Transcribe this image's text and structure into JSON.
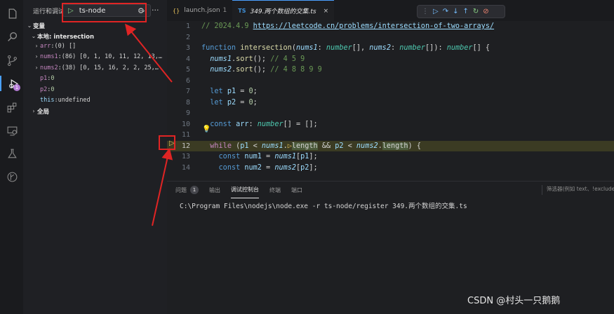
{
  "activity_bar": {
    "icons": [
      "explorer-icon",
      "search-icon",
      "source-control-icon",
      "run-debug-icon",
      "extensions-icon",
      "remote-explorer-icon",
      "testing-icon",
      "git-graph-icon"
    ],
    "debug_badge": "1"
  },
  "sidebar": {
    "title": "运行和调试",
    "config_name": "ts-node",
    "variables_header": "变量",
    "local_scope": "本地: intersection",
    "vars": [
      {
        "name": "arr",
        "value": "(0) []"
      },
      {
        "name": "nums1",
        "value": "(86) [0, 1, 10, 11, 12, 13,…"
      },
      {
        "name": "nums2",
        "value": "(38) [0, 15, 16, 2, 2, 25,…"
      },
      {
        "name": "p1",
        "value": "0"
      },
      {
        "name": "p2",
        "value": "0"
      },
      {
        "name": "this",
        "value": "undefined"
      }
    ],
    "global_scope": "全局"
  },
  "tabs": [
    {
      "label": "launch.json",
      "badge": "1",
      "active": false
    },
    {
      "label": "349.两个数组的交集.ts",
      "active": true
    }
  ],
  "code": {
    "line_numbers": [
      "1",
      "2",
      "3",
      "4",
      "5",
      "6",
      "7",
      "8",
      "9",
      "10",
      "11",
      "12",
      "13",
      "14"
    ],
    "current_line": "12",
    "comment_date": "// 2024.4.9 ",
    "comment_url": "https://leetcode.cn/problems/intersection-of-two-arrays/",
    "sort1_comment": "// 4 5 9",
    "sort2_comment": "// 4 8 8 9 9"
  },
  "panel": {
    "tabs": [
      "问题",
      "输出",
      "调试控制台",
      "终端",
      "端口"
    ],
    "problems_count": "1",
    "active_tab": "调试控制台",
    "filter_placeholder": "筛选器(例如 text、!exclude",
    "console_output": "C:\\Program Files\\nodejs\\node.exe -r ts-node/register 349.两个数组的交集.ts"
  },
  "watermark": "CSDN @村头一只鹅鹅"
}
